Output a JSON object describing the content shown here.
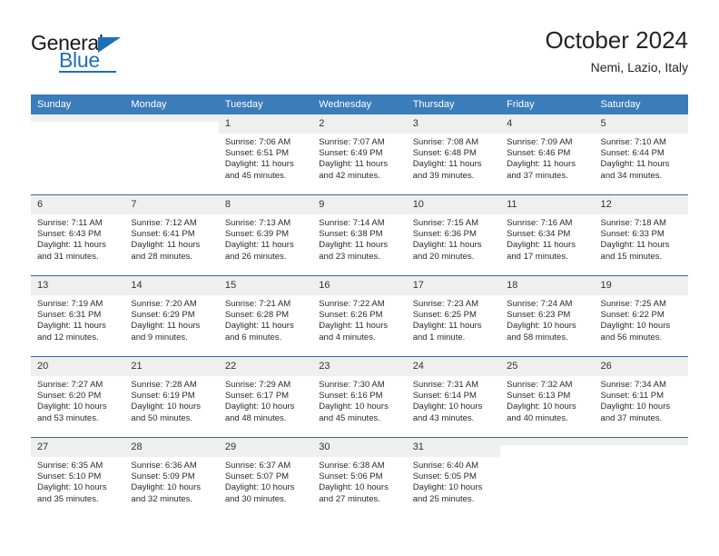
{
  "brand": {
    "name_part1": "General",
    "name_part2": "Blue"
  },
  "header": {
    "month_title": "October 2024",
    "location": "Nemi, Lazio, Italy"
  },
  "colors": {
    "header_blue": "#3b7cbb",
    "row_divider_blue": "#2d6ca8",
    "daynum_band": "#efefef",
    "brand_blue": "#1d70b8",
    "text": "#2b2b2b"
  },
  "weekday_headers": [
    "Sunday",
    "Monday",
    "Tuesday",
    "Wednesday",
    "Thursday",
    "Friday",
    "Saturday"
  ],
  "weeks": [
    [
      {
        "day": "",
        "empty": true,
        "sunrise": "",
        "sunset": "",
        "daylight_line1": "",
        "daylight_line2": ""
      },
      {
        "day": "",
        "empty": true,
        "sunrise": "",
        "sunset": "",
        "daylight_line1": "",
        "daylight_line2": ""
      },
      {
        "day": "1",
        "empty": false,
        "sunrise": "Sunrise: 7:06 AM",
        "sunset": "Sunset: 6:51 PM",
        "daylight_line1": "Daylight: 11 hours",
        "daylight_line2": "and 45 minutes."
      },
      {
        "day": "2",
        "empty": false,
        "sunrise": "Sunrise: 7:07 AM",
        "sunset": "Sunset: 6:49 PM",
        "daylight_line1": "Daylight: 11 hours",
        "daylight_line2": "and 42 minutes."
      },
      {
        "day": "3",
        "empty": false,
        "sunrise": "Sunrise: 7:08 AM",
        "sunset": "Sunset: 6:48 PM",
        "daylight_line1": "Daylight: 11 hours",
        "daylight_line2": "and 39 minutes."
      },
      {
        "day": "4",
        "empty": false,
        "sunrise": "Sunrise: 7:09 AM",
        "sunset": "Sunset: 6:46 PM",
        "daylight_line1": "Daylight: 11 hours",
        "daylight_line2": "and 37 minutes."
      },
      {
        "day": "5",
        "empty": false,
        "sunrise": "Sunrise: 7:10 AM",
        "sunset": "Sunset: 6:44 PM",
        "daylight_line1": "Daylight: 11 hours",
        "daylight_line2": "and 34 minutes."
      }
    ],
    [
      {
        "day": "6",
        "empty": false,
        "sunrise": "Sunrise: 7:11 AM",
        "sunset": "Sunset: 6:43 PM",
        "daylight_line1": "Daylight: 11 hours",
        "daylight_line2": "and 31 minutes."
      },
      {
        "day": "7",
        "empty": false,
        "sunrise": "Sunrise: 7:12 AM",
        "sunset": "Sunset: 6:41 PM",
        "daylight_line1": "Daylight: 11 hours",
        "daylight_line2": "and 28 minutes."
      },
      {
        "day": "8",
        "empty": false,
        "sunrise": "Sunrise: 7:13 AM",
        "sunset": "Sunset: 6:39 PM",
        "daylight_line1": "Daylight: 11 hours",
        "daylight_line2": "and 26 minutes."
      },
      {
        "day": "9",
        "empty": false,
        "sunrise": "Sunrise: 7:14 AM",
        "sunset": "Sunset: 6:38 PM",
        "daylight_line1": "Daylight: 11 hours",
        "daylight_line2": "and 23 minutes."
      },
      {
        "day": "10",
        "empty": false,
        "sunrise": "Sunrise: 7:15 AM",
        "sunset": "Sunset: 6:36 PM",
        "daylight_line1": "Daylight: 11 hours",
        "daylight_line2": "and 20 minutes."
      },
      {
        "day": "11",
        "empty": false,
        "sunrise": "Sunrise: 7:16 AM",
        "sunset": "Sunset: 6:34 PM",
        "daylight_line1": "Daylight: 11 hours",
        "daylight_line2": "and 17 minutes."
      },
      {
        "day": "12",
        "empty": false,
        "sunrise": "Sunrise: 7:18 AM",
        "sunset": "Sunset: 6:33 PM",
        "daylight_line1": "Daylight: 11 hours",
        "daylight_line2": "and 15 minutes."
      }
    ],
    [
      {
        "day": "13",
        "empty": false,
        "sunrise": "Sunrise: 7:19 AM",
        "sunset": "Sunset: 6:31 PM",
        "daylight_line1": "Daylight: 11 hours",
        "daylight_line2": "and 12 minutes."
      },
      {
        "day": "14",
        "empty": false,
        "sunrise": "Sunrise: 7:20 AM",
        "sunset": "Sunset: 6:29 PM",
        "daylight_line1": "Daylight: 11 hours",
        "daylight_line2": "and 9 minutes."
      },
      {
        "day": "15",
        "empty": false,
        "sunrise": "Sunrise: 7:21 AM",
        "sunset": "Sunset: 6:28 PM",
        "daylight_line1": "Daylight: 11 hours",
        "daylight_line2": "and 6 minutes."
      },
      {
        "day": "16",
        "empty": false,
        "sunrise": "Sunrise: 7:22 AM",
        "sunset": "Sunset: 6:26 PM",
        "daylight_line1": "Daylight: 11 hours",
        "daylight_line2": "and 4 minutes."
      },
      {
        "day": "17",
        "empty": false,
        "sunrise": "Sunrise: 7:23 AM",
        "sunset": "Sunset: 6:25 PM",
        "daylight_line1": "Daylight: 11 hours",
        "daylight_line2": "and 1 minute."
      },
      {
        "day": "18",
        "empty": false,
        "sunrise": "Sunrise: 7:24 AM",
        "sunset": "Sunset: 6:23 PM",
        "daylight_line1": "Daylight: 10 hours",
        "daylight_line2": "and 58 minutes."
      },
      {
        "day": "19",
        "empty": false,
        "sunrise": "Sunrise: 7:25 AM",
        "sunset": "Sunset: 6:22 PM",
        "daylight_line1": "Daylight: 10 hours",
        "daylight_line2": "and 56 minutes."
      }
    ],
    [
      {
        "day": "20",
        "empty": false,
        "sunrise": "Sunrise: 7:27 AM",
        "sunset": "Sunset: 6:20 PM",
        "daylight_line1": "Daylight: 10 hours",
        "daylight_line2": "and 53 minutes."
      },
      {
        "day": "21",
        "empty": false,
        "sunrise": "Sunrise: 7:28 AM",
        "sunset": "Sunset: 6:19 PM",
        "daylight_line1": "Daylight: 10 hours",
        "daylight_line2": "and 50 minutes."
      },
      {
        "day": "22",
        "empty": false,
        "sunrise": "Sunrise: 7:29 AM",
        "sunset": "Sunset: 6:17 PM",
        "daylight_line1": "Daylight: 10 hours",
        "daylight_line2": "and 48 minutes."
      },
      {
        "day": "23",
        "empty": false,
        "sunrise": "Sunrise: 7:30 AM",
        "sunset": "Sunset: 6:16 PM",
        "daylight_line1": "Daylight: 10 hours",
        "daylight_line2": "and 45 minutes."
      },
      {
        "day": "24",
        "empty": false,
        "sunrise": "Sunrise: 7:31 AM",
        "sunset": "Sunset: 6:14 PM",
        "daylight_line1": "Daylight: 10 hours",
        "daylight_line2": "and 43 minutes."
      },
      {
        "day": "25",
        "empty": false,
        "sunrise": "Sunrise: 7:32 AM",
        "sunset": "Sunset: 6:13 PM",
        "daylight_line1": "Daylight: 10 hours",
        "daylight_line2": "and 40 minutes."
      },
      {
        "day": "26",
        "empty": false,
        "sunrise": "Sunrise: 7:34 AM",
        "sunset": "Sunset: 6:11 PM",
        "daylight_line1": "Daylight: 10 hours",
        "daylight_line2": "and 37 minutes."
      }
    ],
    [
      {
        "day": "27",
        "empty": false,
        "sunrise": "Sunrise: 6:35 AM",
        "sunset": "Sunset: 5:10 PM",
        "daylight_line1": "Daylight: 10 hours",
        "daylight_line2": "and 35 minutes."
      },
      {
        "day": "28",
        "empty": false,
        "sunrise": "Sunrise: 6:36 AM",
        "sunset": "Sunset: 5:09 PM",
        "daylight_line1": "Daylight: 10 hours",
        "daylight_line2": "and 32 minutes."
      },
      {
        "day": "29",
        "empty": false,
        "sunrise": "Sunrise: 6:37 AM",
        "sunset": "Sunset: 5:07 PM",
        "daylight_line1": "Daylight: 10 hours",
        "daylight_line2": "and 30 minutes."
      },
      {
        "day": "30",
        "empty": false,
        "sunrise": "Sunrise: 6:38 AM",
        "sunset": "Sunset: 5:06 PM",
        "daylight_line1": "Daylight: 10 hours",
        "daylight_line2": "and 27 minutes."
      },
      {
        "day": "31",
        "empty": false,
        "sunrise": "Sunrise: 6:40 AM",
        "sunset": "Sunset: 5:05 PM",
        "daylight_line1": "Daylight: 10 hours",
        "daylight_line2": "and 25 minutes."
      },
      {
        "day": "",
        "empty": true,
        "sunrise": "",
        "sunset": "",
        "daylight_line1": "",
        "daylight_line2": ""
      },
      {
        "day": "",
        "empty": true,
        "sunrise": "",
        "sunset": "",
        "daylight_line1": "",
        "daylight_line2": ""
      }
    ]
  ]
}
